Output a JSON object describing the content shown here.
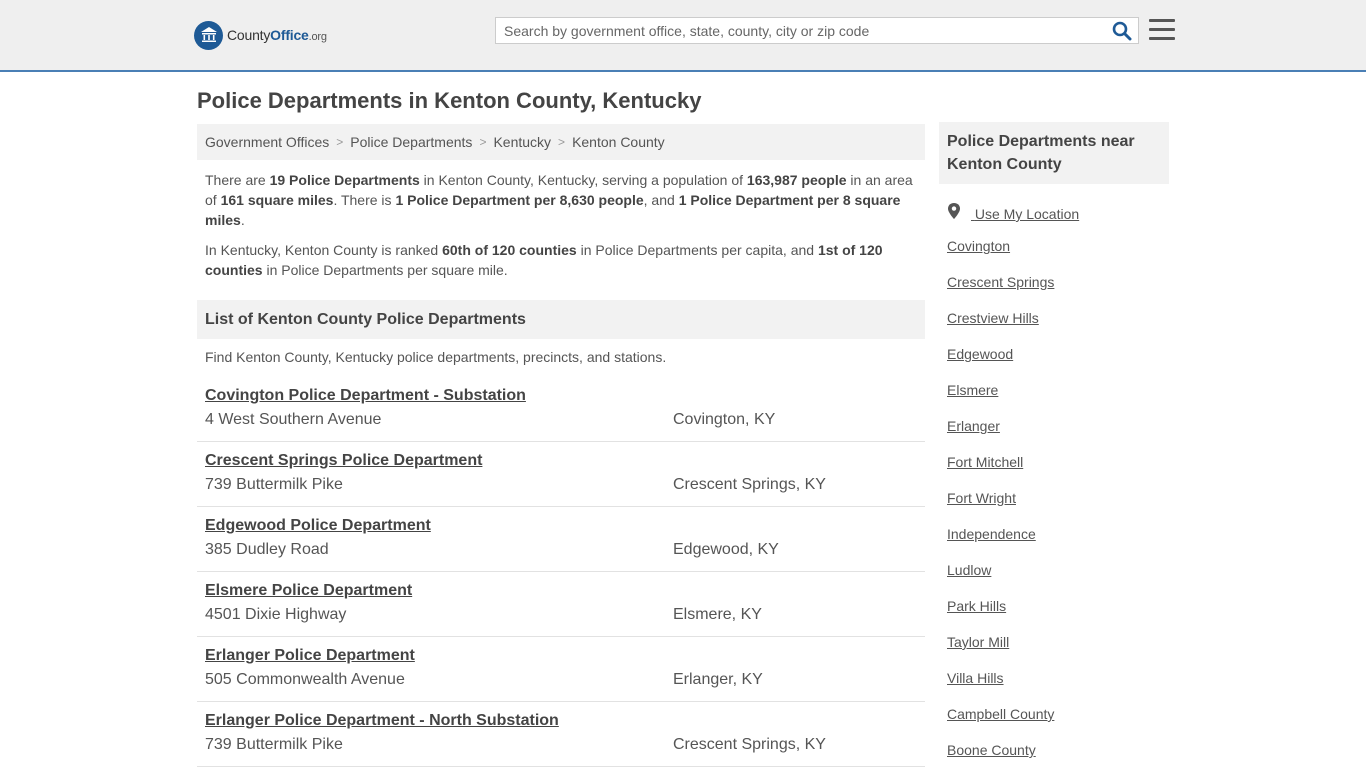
{
  "header": {
    "logo": {
      "part1": "County",
      "part2": "Office",
      "part3": ".org"
    },
    "search": {
      "placeholder": "Search by government office, state, county, city or zip code"
    },
    "icons": {
      "search": "search-icon",
      "menu": "hamburger-menu-icon",
      "logo": "county-office-logo-icon"
    }
  },
  "page": {
    "title": "Police Departments in Kenton County, Kentucky"
  },
  "breadcrumb": [
    "Government Offices",
    "Police Departments",
    "Kentucky",
    "Kenton County"
  ],
  "intro": {
    "p1": {
      "t1": "There are ",
      "b1": "19 Police Departments",
      "t2": " in Kenton County, Kentucky, serving a population of ",
      "b2": "163,987 people",
      "t3": " in an area of ",
      "b3": "161 square miles",
      "t4": ". There is ",
      "b4": "1 Police Department per 8,630 people",
      "t5": ", and ",
      "b5": "1 Police Department per 8 square miles",
      "t6": "."
    },
    "p2": {
      "t1": "In Kentucky, Kenton County is ranked ",
      "b1": "60th of 120 counties",
      "t2": " in Police Departments per capita, and ",
      "b2": "1st of 120 counties",
      "t3": " in Police Departments per square mile."
    }
  },
  "list": {
    "heading": "List of Kenton County Police Departments",
    "description": "Find Kenton County, Kentucky police departments, precincts, and stations.",
    "items": [
      {
        "name": "Covington Police Department - Substation",
        "address": "4 West Southern Avenue",
        "city": "Covington, KY"
      },
      {
        "name": "Crescent Springs Police Department",
        "address": "739 Buttermilk Pike",
        "city": "Crescent Springs, KY"
      },
      {
        "name": "Edgewood Police Department",
        "address": "385 Dudley Road",
        "city": "Edgewood, KY"
      },
      {
        "name": "Elsmere Police Department",
        "address": "4501 Dixie Highway",
        "city": "Elsmere, KY"
      },
      {
        "name": "Erlanger Police Department",
        "address": "505 Commonwealth Avenue",
        "city": "Erlanger, KY"
      },
      {
        "name": "Erlanger Police Department - North Substation",
        "address": "739 Buttermilk Pike",
        "city": "Crescent Springs, KY"
      }
    ]
  },
  "sidebar": {
    "heading": "Police Departments near Kenton County",
    "use_location": "Use My Location",
    "links": [
      "Covington",
      "Crescent Springs",
      "Crestview Hills",
      "Edgewood",
      "Elsmere",
      "Erlanger",
      "Fort Mitchell",
      "Fort Wright",
      "Independence",
      "Ludlow",
      "Park Hills",
      "Taylor Mill",
      "Villa Hills",
      "Campbell County",
      "Boone County"
    ]
  },
  "colors": {
    "accent": "#1e5a96",
    "header_border": "#4a7fb5",
    "panel": "#f2f2f2",
    "text": "#555555"
  }
}
